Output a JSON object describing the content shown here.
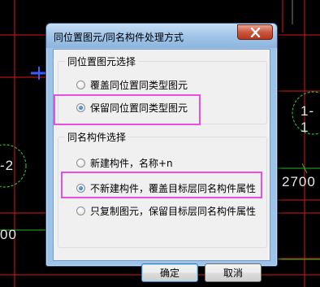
{
  "background": {
    "labels": {
      "left_top": "-2",
      "left_bottom": "00",
      "right_top": "1-1",
      "right_mid": "2700"
    }
  },
  "dialog": {
    "title": "同位置图元/同名构件处理方式",
    "close_icon": "close-x-icon",
    "group_same_position": {
      "title": "同位置图元选择",
      "options": [
        {
          "label": "覆盖同位置同类型图元",
          "checked": false
        },
        {
          "label": "保留同位置同类型图元",
          "checked": true
        }
      ]
    },
    "group_same_name": {
      "title": "同名构件选择",
      "options": [
        {
          "label": "新建构件，名称+n",
          "checked": false
        },
        {
          "label": "不新建构件，覆盖目标层同名构件属性",
          "checked": true
        },
        {
          "label": "只复制图元，保留目标层同名构件属性",
          "checked": false
        }
      ]
    },
    "ok_label": "确定",
    "cancel_label": "取消"
  },
  "colors": {
    "highlight": "#e84ee0",
    "cad_red": "#d81919",
    "cad_green": "#2db32d",
    "cad_blue": "#3a5cff",
    "title_bar": "#9ec3e8"
  }
}
